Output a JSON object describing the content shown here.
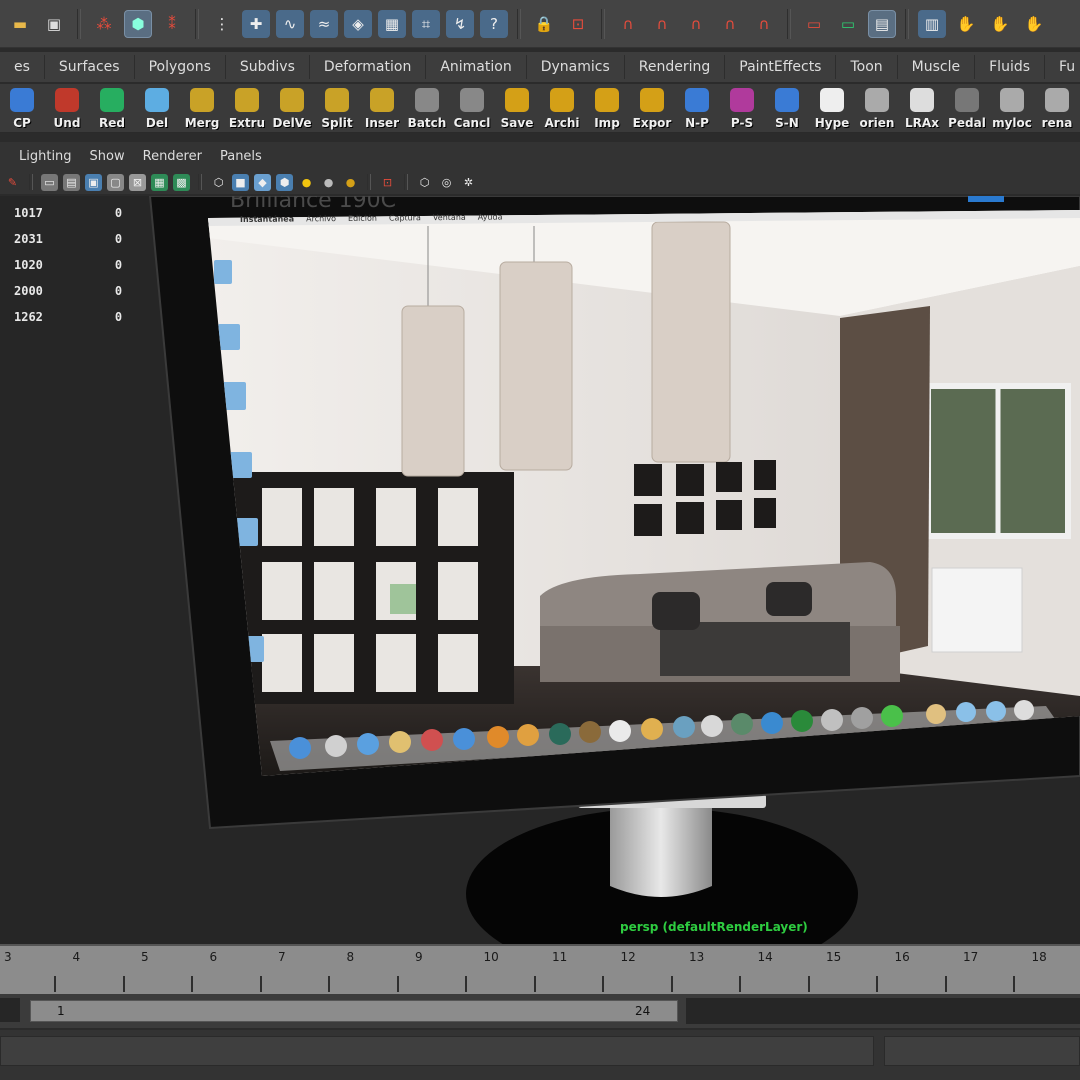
{
  "menu_tabs": [
    "es",
    "Surfaces",
    "Polygons",
    "Subdivs",
    "Deformation",
    "Animation",
    "Dynamics",
    "Rendering",
    "PaintEffects",
    "Toon",
    "Muscle",
    "Fluids",
    "Fu"
  ],
  "shelf": [
    {
      "label": "CP",
      "color": "#3a7bd5"
    },
    {
      "label": "Und",
      "color": "#c0392b"
    },
    {
      "label": "Red",
      "color": "#27ae60"
    },
    {
      "label": "Del",
      "color": "#5dade2"
    },
    {
      "label": "Merg",
      "color": "#c9a227"
    },
    {
      "label": "Extru",
      "color": "#c9a227"
    },
    {
      "label": "DelVe",
      "color": "#c9a227"
    },
    {
      "label": "Split",
      "color": "#c9a227"
    },
    {
      "label": "Inser",
      "color": "#c9a227"
    },
    {
      "label": "Batch",
      "color": "#888888"
    },
    {
      "label": "Cancl",
      "color": "#888888"
    },
    {
      "label": "Save",
      "color": "#d4a017"
    },
    {
      "label": "Archi",
      "color": "#d4a017"
    },
    {
      "label": "Imp",
      "color": "#d4a017"
    },
    {
      "label": "Expor",
      "color": "#d4a017"
    },
    {
      "label": "N-P",
      "color": "#3a7bd5"
    },
    {
      "label": "P-S",
      "color": "#b03a9c"
    },
    {
      "label": "S-N",
      "color": "#3a7bd5"
    },
    {
      "label": "Hype",
      "color": "#eeeeee"
    },
    {
      "label": "orien",
      "color": "#aaaaaa"
    },
    {
      "label": "LRAx",
      "color": "#dddddd"
    },
    {
      "label": "Pedal",
      "color": "#777777"
    },
    {
      "label": "myloc",
      "color": "#aaaaaa"
    },
    {
      "label": "rena",
      "color": "#aaaaaa"
    }
  ],
  "panel_menu": [
    "Lighting",
    "Show",
    "Renderer",
    "Panels"
  ],
  "hud": {
    "rows": [
      {
        "a": "1017",
        "b": "0"
      },
      {
        "a": "2031",
        "b": "0"
      },
      {
        "a": "1020",
        "b": "0"
      },
      {
        "a": "2000",
        "b": "0"
      },
      {
        "a": "1262",
        "b": "0"
      }
    ],
    "camera_label": "persp (defaultRenderLayer)"
  },
  "monitor": {
    "brand": "Brilliance 190C",
    "mac_menu": [
      "Instantánea",
      "Archivo",
      "Edición",
      "Captura",
      "Ventana",
      "Ayuda"
    ]
  },
  "timeline": {
    "frames": [
      "3",
      "4",
      "5",
      "6",
      "7",
      "8",
      "9",
      "10",
      "11",
      "12",
      "13",
      "14",
      "15",
      "16",
      "17",
      "18"
    ],
    "range_start": "1",
    "range_end": "24"
  },
  "colors": {
    "accent": "#5a6e82",
    "hud_green": "#2ecc40"
  }
}
